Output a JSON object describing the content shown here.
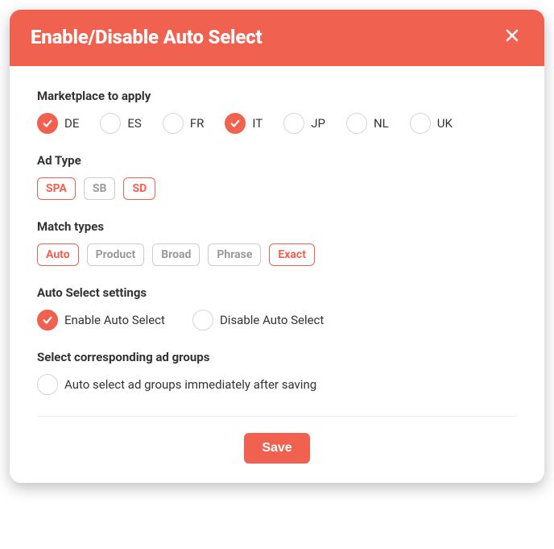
{
  "colors": {
    "accent": "#f1614f"
  },
  "modal": {
    "title": "Enable/Disable Auto Select",
    "close_icon": "close"
  },
  "marketplace": {
    "label": "Marketplace to apply",
    "options": [
      {
        "code": "DE",
        "selected": true
      },
      {
        "code": "ES",
        "selected": false
      },
      {
        "code": "FR",
        "selected": false
      },
      {
        "code": "IT",
        "selected": true
      },
      {
        "code": "JP",
        "selected": false
      },
      {
        "code": "NL",
        "selected": false
      },
      {
        "code": "UK",
        "selected": false
      }
    ]
  },
  "ad_type": {
    "label": "Ad Type",
    "options": [
      {
        "code": "SPA",
        "selected": true
      },
      {
        "code": "SB",
        "selected": false
      },
      {
        "code": "SD",
        "selected": true
      }
    ]
  },
  "match_types": {
    "label": "Match types",
    "options": [
      {
        "code": "Auto",
        "selected": true
      },
      {
        "code": "Product",
        "selected": false
      },
      {
        "code": "Broad",
        "selected": false
      },
      {
        "code": "Phrase",
        "selected": false
      },
      {
        "code": "Exact",
        "selected": true
      }
    ]
  },
  "auto_select": {
    "label": "Auto Select settings",
    "enable_label": "Enable Auto Select",
    "disable_label": "Disable Auto Select",
    "value": "enable"
  },
  "ad_groups": {
    "label": "Select corresponding ad groups",
    "checkbox_label": "Auto select ad groups immediately after saving",
    "checked": false
  },
  "footer": {
    "save_label": "Save"
  }
}
